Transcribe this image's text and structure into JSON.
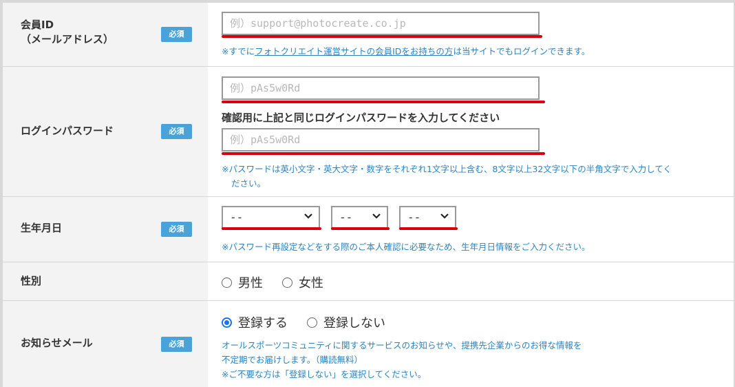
{
  "required_badge": "必須",
  "member_id": {
    "label_line1": "会員ID",
    "label_line2": "（メールアドレス）",
    "placeholder": "例）support@photocreate.co.jp",
    "note_prefix": "※すでに",
    "note_link": "フォトクリエイト運営サイトの会員IDをお持ちの方",
    "note_suffix": "は当サイトでもログインできます。"
  },
  "password": {
    "label": "ログインパスワード",
    "placeholder": "例）pAs5w0Rd",
    "confirm_heading": "確認用に上記と同じログインパスワードを入力してください",
    "confirm_placeholder": "例）pAs5w0Rd",
    "note_line1": "※パスワードは英小文字・英大文字・数字をそれぞれ1文字以上含む、8文字以上32文字以下の半角文字で入力してく",
    "note_line2": "ださい。"
  },
  "birthday": {
    "label": "生年月日",
    "year_value": "--",
    "month_value": "--",
    "day_value": "--",
    "note": "※パスワード再設定などをする際のご本人確認に必要なため、生年月日情報をご入力ください。"
  },
  "gender": {
    "label": "性別",
    "options": [
      "男性",
      "女性"
    ]
  },
  "newsletter": {
    "label": "お知らせメール",
    "options": [
      "登録する",
      "登録しない"
    ],
    "selected_index": 0,
    "note_line1": "オールスポーツコミュニティに関するサービスのお知らせや、提携先企業からのお得な情報を",
    "note_line2": "不定期でお届けします。（購読無料）",
    "note_line3": "※ご不要な方は「登録しない」を選択してください。"
  },
  "colors": {
    "required_badge": "#4aa3d8",
    "highlight_underline": "#d7000f",
    "note_text": "#2b84c2",
    "radio_selected": "#1a73e8"
  }
}
